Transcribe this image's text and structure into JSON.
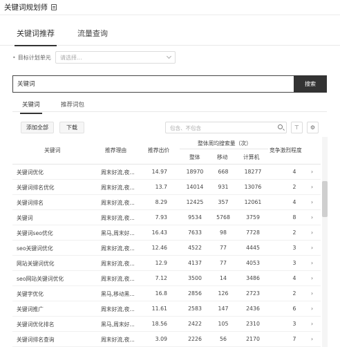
{
  "header": {
    "title": "关键词规划师"
  },
  "main_tabs": [
    {
      "label": "关键词推荐"
    },
    {
      "label": "流量查询"
    }
  ],
  "unit": {
    "label": "目标计划单元",
    "placeholder": "请选择..."
  },
  "search": {
    "value": "关键词",
    "button": "搜索"
  },
  "sub_tabs": [
    {
      "label": "关键词"
    },
    {
      "label": "推荐词包"
    }
  ],
  "toolbar": {
    "add_all": "添加全部",
    "download": "下载",
    "filter_placeholder": "包含、不包含"
  },
  "table": {
    "headers": {
      "keyword": "关键词",
      "reason": "推荐理由",
      "bid": "推荐出价",
      "group": "整体周均搜索量（次）",
      "total": "整体",
      "mobile": "移动",
      "pc": "计算机",
      "competition": "竞争激烈程度"
    },
    "rows": [
      {
        "keyword": "关键词优化",
        "reason": "周末好流,夜...",
        "bid": "14.97",
        "total": "18970",
        "mobile": "668",
        "pc": "18277",
        "competition": "4"
      },
      {
        "keyword": "关键词排名优化",
        "reason": "周末好流,夜...",
        "bid": "13.7",
        "total": "14014",
        "mobile": "931",
        "pc": "13076",
        "competition": "2"
      },
      {
        "keyword": "关键词排名",
        "reason": "周末好流,夜...",
        "bid": "8.29",
        "total": "12425",
        "mobile": "357",
        "pc": "12061",
        "competition": "4"
      },
      {
        "keyword": "关键词",
        "reason": "周末好流,夜...",
        "bid": "7.93",
        "total": "9534",
        "mobile": "5768",
        "pc": "3759",
        "competition": "8"
      },
      {
        "keyword": "关键词seo优化",
        "reason": "黑马,周末好...",
        "bid": "16.43",
        "total": "7633",
        "mobile": "98",
        "pc": "7728",
        "competition": "2"
      },
      {
        "keyword": "seo关键词优化",
        "reason": "周末好流,夜...",
        "bid": "12.46",
        "total": "4522",
        "mobile": "77",
        "pc": "4445",
        "competition": "3"
      },
      {
        "keyword": "网站关键词优化",
        "reason": "周末好流,夜...",
        "bid": "12.9",
        "total": "4137",
        "mobile": "77",
        "pc": "4053",
        "competition": "3"
      },
      {
        "keyword": "seo网站关键词优化",
        "reason": "周末好流,夜...",
        "bid": "7.12",
        "total": "3500",
        "mobile": "14",
        "pc": "3486",
        "competition": "4"
      },
      {
        "keyword": "关键字优化",
        "reason": "黑马,移动黑...",
        "bid": "16.8",
        "total": "2856",
        "mobile": "126",
        "pc": "2723",
        "competition": "2"
      },
      {
        "keyword": "关键词推广",
        "reason": "周末好流,夜...",
        "bid": "11.61",
        "total": "2583",
        "mobile": "147",
        "pc": "2436",
        "competition": "6"
      },
      {
        "keyword": "关键词优化排名",
        "reason": "黑马,周末好...",
        "bid": "18.56",
        "total": "2422",
        "mobile": "105",
        "pc": "2310",
        "competition": "3"
      },
      {
        "keyword": "关键词排名查询",
        "reason": "周末好流,夜...",
        "bid": "3.09",
        "total": "2226",
        "mobile": "56",
        "pc": "2170",
        "competition": "7"
      }
    ]
  }
}
